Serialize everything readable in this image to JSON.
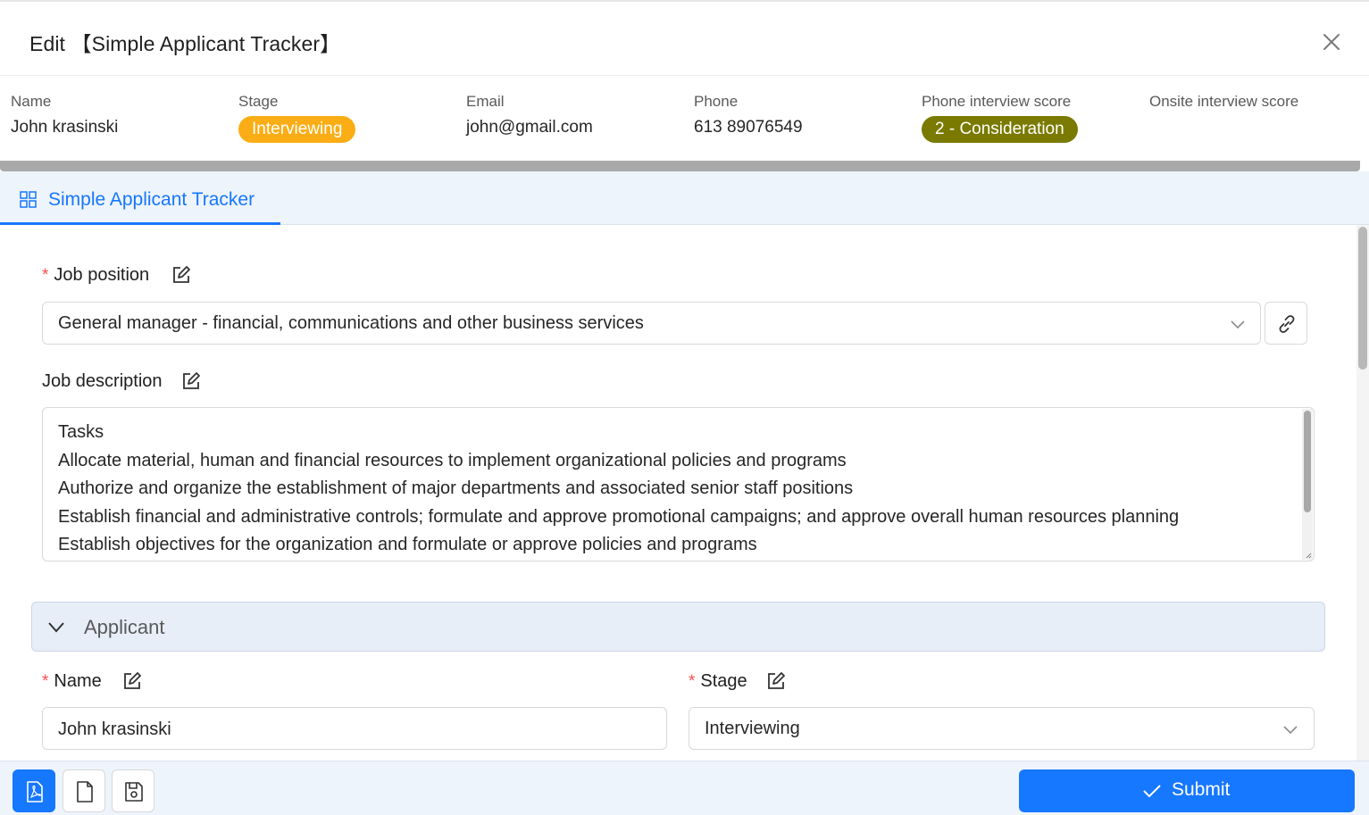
{
  "dialog": {
    "title": "Edit 【Simple Applicant Tracker】"
  },
  "summary": {
    "name_label": "Name",
    "name_value": "John krasinski",
    "stage_label": "Stage",
    "stage_value": "Interviewing",
    "stage_color": "#faad14",
    "email_label": "Email",
    "email_value": "john@gmail.com",
    "phone_label": "Phone",
    "phone_value": "613 89076549",
    "phone_score_label": "Phone interview score",
    "phone_score_value": "2 - Consideration",
    "phone_score_color": "#7a7a00",
    "onsite_score_label": "Onsite interview score"
  },
  "tab": {
    "label": "Simple Applicant Tracker"
  },
  "form": {
    "job_position_label": "Job position",
    "job_position_value": "General manager - financial, communications and other business services",
    "job_description_label": "Job description",
    "job_description_lines": [
      "Tasks",
      "Allocate material, human and financial resources to implement organizational policies and programs",
      "Authorize and organize the establishment of major departments and associated senior staff positions",
      "Establish financial and administrative controls; formulate and approve promotional campaigns; and approve overall human resources planning",
      "Establish objectives for the organization and formulate or approve policies and programs"
    ],
    "applicant_section_label": "Applicant",
    "name_label": "Name",
    "name_value": "John krasinski",
    "stage_label": "Stage",
    "stage_value": "Interviewing",
    "required_mark": "*"
  },
  "footer": {
    "submit_label": "Submit"
  },
  "colors": {
    "accent": "#1677ff",
    "required": "#ff4d4f"
  }
}
